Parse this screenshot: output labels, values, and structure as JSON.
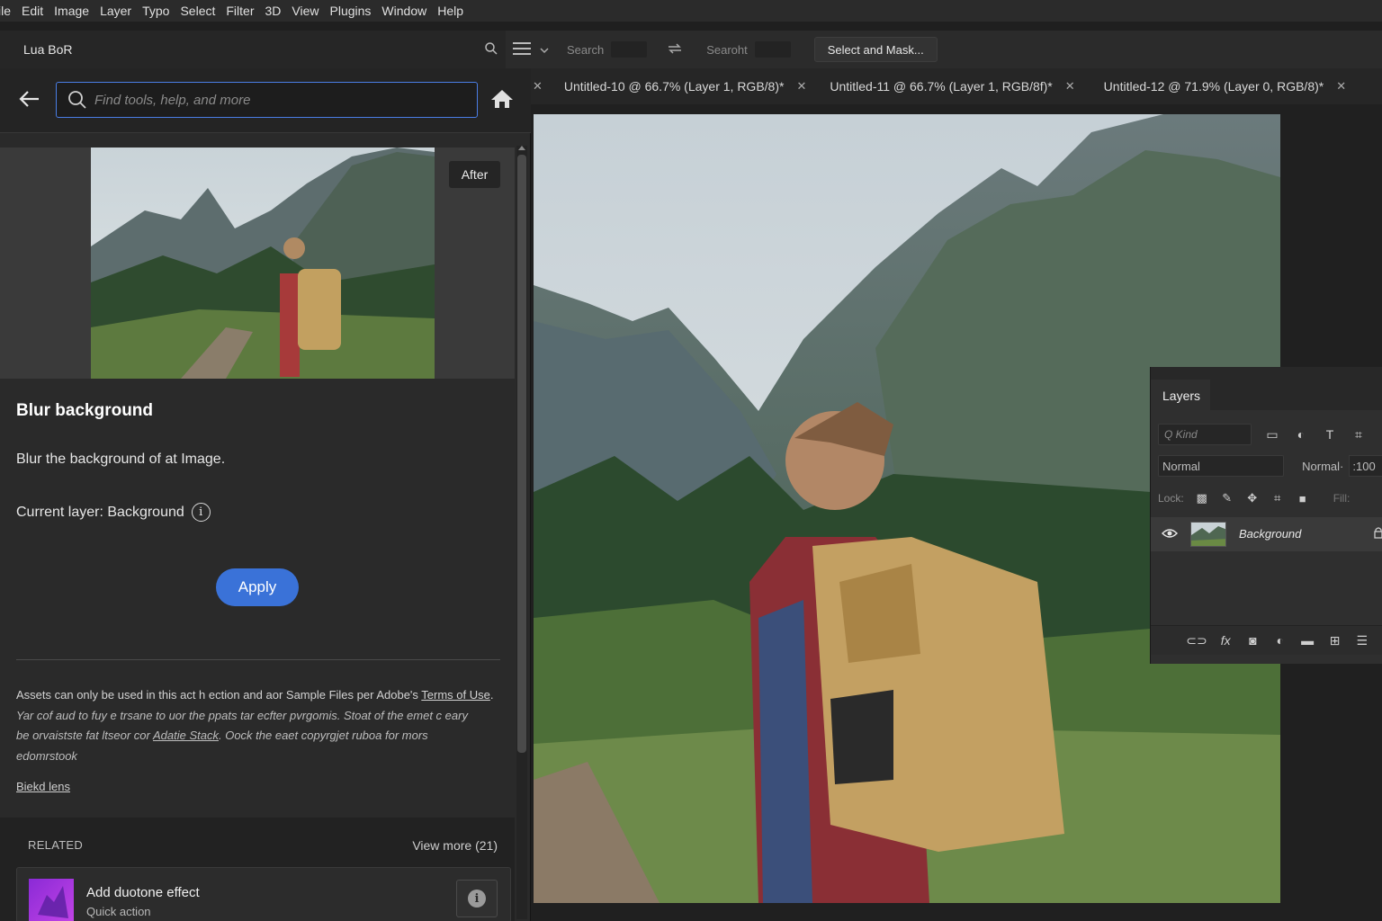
{
  "menu": [
    "ile",
    "Edit",
    "Image",
    "Layer",
    "Typo",
    "Select",
    "Filter",
    "3D",
    "View",
    "Plugins",
    "Window",
    "Help"
  ],
  "options_bar": {
    "panel_label": "Lua BoR",
    "search_label_1": "Search",
    "search_label_2": "Searoht",
    "select_mask": "Select and Mask..."
  },
  "discover": {
    "search_placeholder": "Find tools, help, and more",
    "after_label": "After",
    "title": "Blur background",
    "description": "Blur the background of at Image.",
    "current_layer": "Current layer: Background",
    "apply": "Apply",
    "legal_line1_a": "Assets can only be used in this act h ection and aor Sample Files per Adobe's ",
    "legal_line1_link": "Terms of Use",
    "legal_line1_b": ".",
    "legal_line2": "Yar cof aud to fuy e trsane to uor the ppats tar ecfter pvrgomis. Stoat of the emet c eary",
    "legal_line3_a": "be orvaistste fat ltseor cor ",
    "legal_line3_link": "Adatie Stack",
    "legal_line3_b": ". Oock the eaet copyrgjet ruboa for mors",
    "legal_line4": "edomrstook",
    "legal_link": "Biekd lens",
    "related_header": "RELATED",
    "view_more": "View more (21)",
    "related_item_title": "Add duotone effect",
    "related_item_sub": "Quick action"
  },
  "doc_tabs": [
    "Untitled-10 @ 66.7% (Layer 1, RGB/8)*",
    "Untitled-11 @ 66.7% (Layer 1, RGB/8f)*",
    "Untitled-12 @ 71.9% (Layer 0, RGB/8)*"
  ],
  "layers_panel": {
    "tab": "Layers",
    "kind_placeholder": "Q Kind",
    "blend_mode": "Normal",
    "opacity_label": "Normal·",
    "opacity_value": ":100",
    "lock_label": "Lock:",
    "fill_label": "Fill:",
    "layer_name": "Background"
  },
  "colors": {
    "accent": "#3a72d8",
    "search_border": "#4a7ee6",
    "panel_bg": "#2a2a2a"
  }
}
